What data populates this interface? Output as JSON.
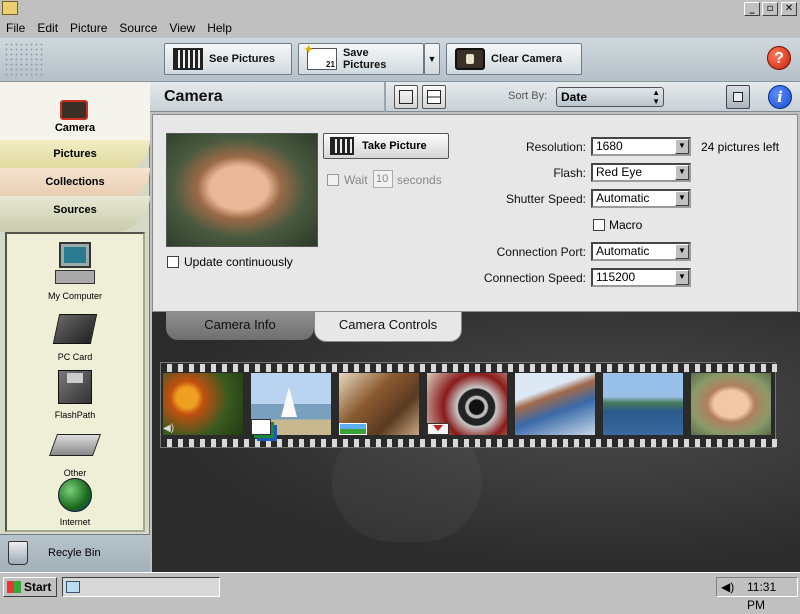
{
  "menu": [
    "File",
    "Edit",
    "Picture",
    "Source",
    "View",
    "Help"
  ],
  "window_buttons": {
    "minimize": "_",
    "maximize": "▫",
    "close": "✕"
  },
  "toolbar": {
    "see_pictures": "See Pictures",
    "save_pictures": "Save Pictures",
    "clear_camera": "Clear Camera",
    "save_date_num": "21",
    "help_glyph": "?"
  },
  "nav": {
    "camera": "Camera",
    "pictures": "Pictures",
    "collections": "Collections",
    "sources": "Sources",
    "devices": [
      "My Computer",
      "PC Card",
      "FlashPath",
      "Other",
      "Internet"
    ],
    "recycle_bin": "Recyle Bin"
  },
  "header": {
    "title": "Camera",
    "sort_label": "Sort By:",
    "sort_value": "Date",
    "info_glyph": "i"
  },
  "panel": {
    "take_picture": "Take Picture",
    "wait_label": "Wait",
    "wait_value": "10",
    "wait_unit": "seconds",
    "wait_checked": false,
    "update_continuously": "Update continuously",
    "update_checked": false,
    "fields": [
      {
        "label": "Resolution:",
        "value": "1680"
      },
      {
        "label": "Flash:",
        "value": "Red Eye"
      },
      {
        "label": "Shutter Speed:",
        "value": "Automatic"
      },
      {
        "label": "Connection Port:",
        "value": "Automatic"
      },
      {
        "label": "Connection Speed:",
        "value": "115200"
      }
    ],
    "pictures_left": "24 pictures left",
    "macro_label": "Macro",
    "macro_checked": false
  },
  "tabs": {
    "camera_info": "Camera Info",
    "camera_controls": "Camera Controls",
    "active": "camera_controls"
  },
  "thumbnails": [
    {
      "subject": "orange flowers",
      "badge": "speaker-icon"
    },
    {
      "subject": "sailboat on lake",
      "badge": "stack-icon"
    },
    {
      "subject": "wooden interior",
      "badge": "panorama-icon"
    },
    {
      "subject": "vintage car wheel",
      "badge": "download-icon"
    },
    {
      "subject": "child playing",
      "badge": ""
    },
    {
      "subject": "coastal bay",
      "badge": ""
    },
    {
      "subject": "smiling girl",
      "badge": ""
    }
  ],
  "taskbar": {
    "start": "Start",
    "clock": "11:31 PM"
  },
  "colors": {
    "accent_blue": "#1a4fd0",
    "help_red": "#d8301c",
    "nav_yellow": "#ece8b4",
    "nav_peach": "#efdcc6",
    "nav_green": "#d8dcc0"
  }
}
